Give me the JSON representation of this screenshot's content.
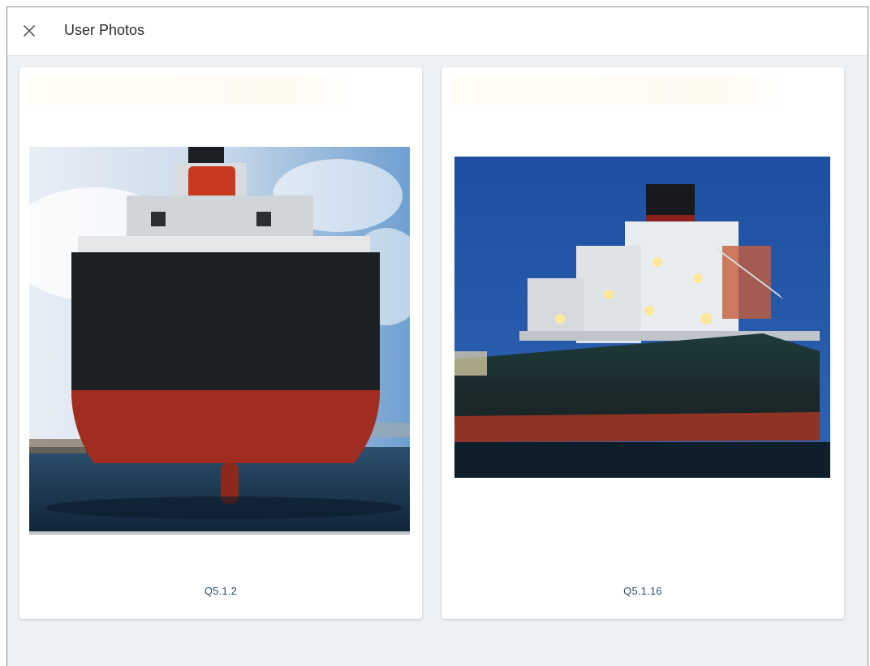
{
  "dialog": {
    "title": "User Photos",
    "close_icon": "close-icon"
  },
  "photos": [
    {
      "caption": "Q5.1.2",
      "alt": "ship-stern-photo"
    },
    {
      "caption": "Q5.1.16",
      "alt": "ship-night-photo"
    }
  ],
  "colors": {
    "background": "#eef1f4",
    "card": "#ffffff",
    "caption_text": "#2f4d66",
    "title_text": "#2b2b2b"
  }
}
